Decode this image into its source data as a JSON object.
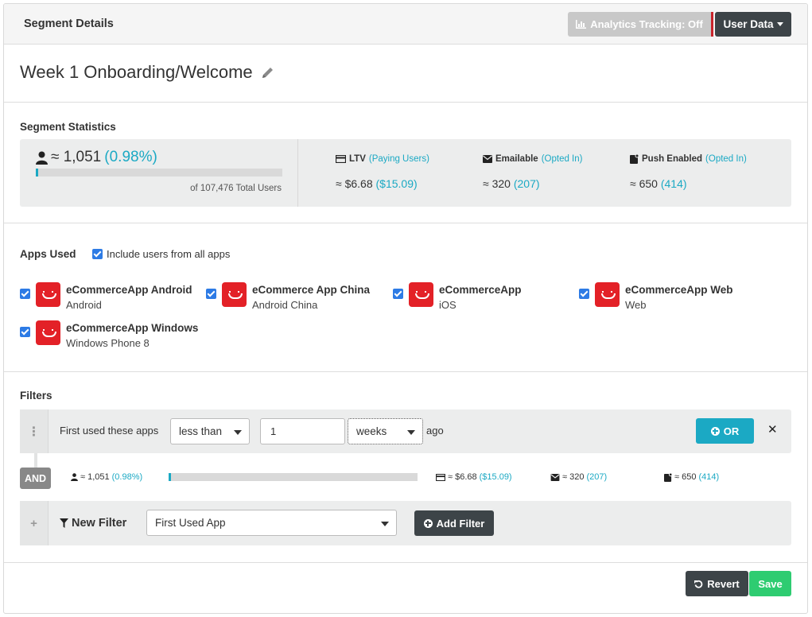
{
  "header": {
    "title": "Segment Details",
    "analytics_button": "Analytics Tracking: Off",
    "user_data_button": "User Data"
  },
  "segment": {
    "name": "Week 1 Onboarding/Welcome"
  },
  "statistics": {
    "label": "Segment Statistics",
    "user_count": "≈ 1,051",
    "user_percent": "(0.98%)",
    "user_fraction": 0.0098,
    "total_users": "of 107,476 Total Users",
    "ltv": {
      "label": "LTV",
      "sub": "(Paying Users)",
      "value": "≈ $6.68",
      "sub_value": "($15.09)"
    },
    "emailable": {
      "label": "Emailable",
      "sub": "(Opted In)",
      "value": "≈ 320",
      "sub_value": "(207)"
    },
    "push": {
      "label": "Push Enabled",
      "sub": "(Opted In)",
      "value": "≈ 650",
      "sub_value": "(414)"
    }
  },
  "apps": {
    "label": "Apps Used",
    "include_all": "Include users from all apps",
    "items": [
      {
        "name": "eCommerceApp Android",
        "platform": "Android"
      },
      {
        "name": "eCommerce App China",
        "platform": "Android China"
      },
      {
        "name": "eCommerceApp",
        "platform": "iOS"
      },
      {
        "name": "eCommerceApp Web",
        "platform": "Web"
      },
      {
        "name": "eCommerceApp Windows",
        "platform": "Windows Phone 8"
      }
    ]
  },
  "filters": {
    "label": "Filters",
    "filter1": {
      "label": "First used these apps",
      "comparator": "less than",
      "value": "1",
      "unit": "weeks",
      "suffix": "ago",
      "or_button": "OR",
      "remove": "✕"
    },
    "and_badge": "AND",
    "sub_stats": {
      "users": "≈ 1,051",
      "users_pct": "(0.98%)",
      "fraction": 0.0098,
      "ltv": "≈ $6.68",
      "ltv_sub": "($15.09)",
      "email": "≈ 320",
      "email_sub": "(207)",
      "push": "≈ 650",
      "push_sub": "(414)"
    },
    "new_filter": {
      "label": "New Filter",
      "select": "First Used App",
      "add_button": "Add Filter"
    }
  },
  "footer": {
    "revert": "Revert",
    "save": "Save"
  }
}
